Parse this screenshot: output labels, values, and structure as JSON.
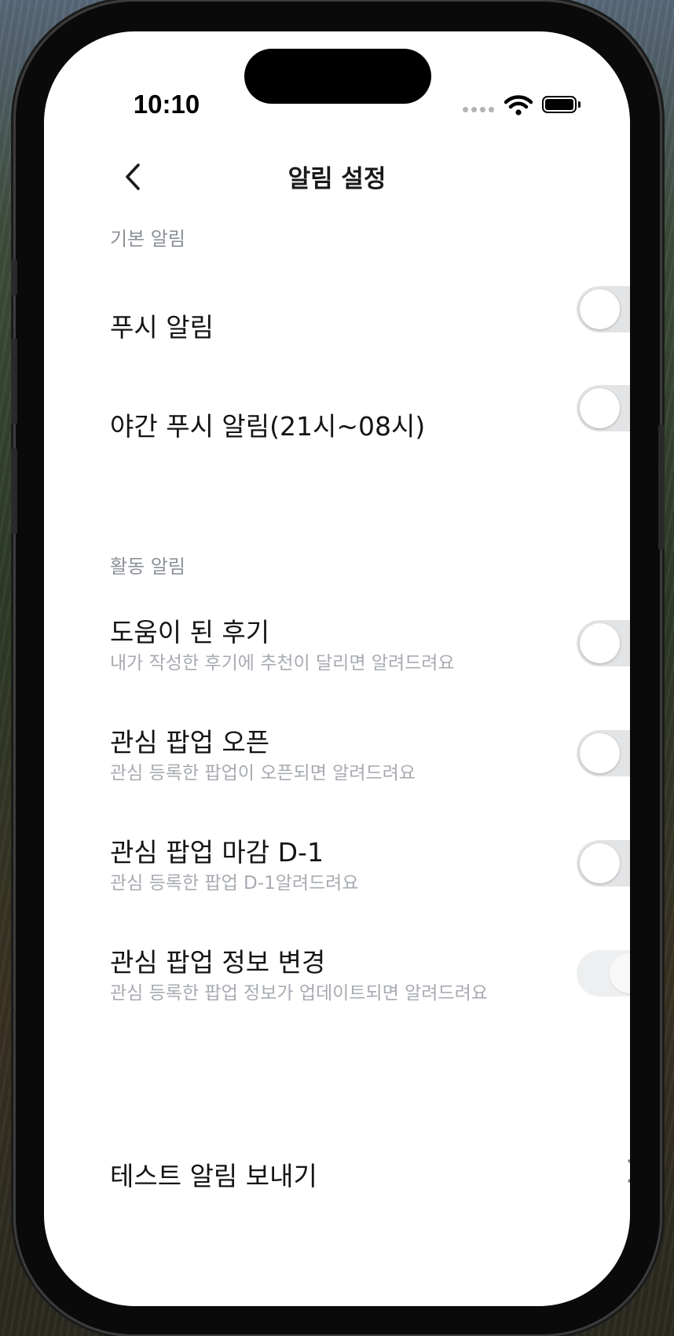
{
  "status_bar": {
    "time": "10:10"
  },
  "header": {
    "title": "알림 설정"
  },
  "basic_section": {
    "header": "기본 알림",
    "items": [
      {
        "title": "푸시 알림",
        "enabled": false
      },
      {
        "title": "야간 푸시 알림(21시~08시)",
        "enabled": false
      }
    ]
  },
  "activity_section": {
    "header": "활동 알림",
    "items": [
      {
        "title": "도움이 된 후기",
        "subtitle": "내가 작성한 후기에 추천이 달리면 알려드려요",
        "enabled": false
      },
      {
        "title": "관심 팝업 오픈",
        "subtitle": "관심 등록한 팝업이 오픈되면 알려드려요",
        "enabled": false
      },
      {
        "title": "관심 팝업 마감 D-1",
        "subtitle": "관심 등록한 팝업 D-1알려드려요",
        "enabled": false
      },
      {
        "title": "관심 팝업 정보 변경",
        "subtitle": "관심 등록한 팝업 정보가 업데이트되면 알려드려요",
        "enabled": true,
        "disabled": true
      }
    ]
  },
  "test_notification": {
    "label": "테스트 알림 보내기"
  },
  "icons": {
    "back": "chevron-left-icon",
    "forward": "chevron-right-icon",
    "wifi": "wifi-icon",
    "battery": "battery-icon",
    "signal": "signal-dots-icon"
  },
  "colors": {
    "toggle_off_track": "#e3e4e6",
    "section_header": "#8b9097",
    "subtitle": "#a7abb1",
    "chevron": "#7d848c"
  }
}
